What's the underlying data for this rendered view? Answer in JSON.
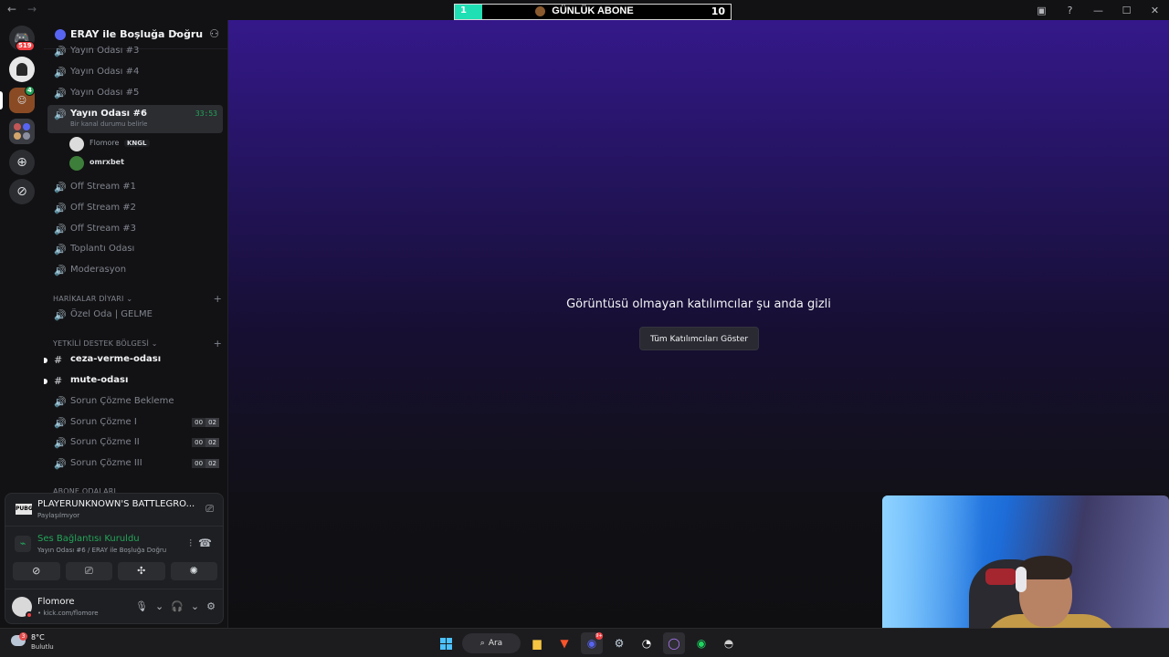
{
  "overlay": {
    "current": "1",
    "title": "GÜNLÜK ABONE",
    "goal": "10",
    "progress": 0.1
  },
  "rail": {
    "dm_badge": "519",
    "server_badge": "4",
    "add_icon": "plus-icon",
    "discover_icon": "compass-icon"
  },
  "guild": {
    "name": "ERAY ile Boşluğa Doğru"
  },
  "channels_top": [
    {
      "name": "Yayın Odası #3"
    },
    {
      "name": "Yayın Odası #4"
    },
    {
      "name": "Yayın Odası #5"
    }
  ],
  "active_channel": {
    "name": "Yayın Odası #6",
    "timer": "33:53",
    "status": "Bir kanal durumu belirle"
  },
  "voice_users": [
    {
      "name": "Flomore",
      "tag": "KNGL"
    },
    {
      "name": "omrxbet"
    }
  ],
  "channels_mid": [
    {
      "name": "Off Stream #1"
    },
    {
      "name": "Off Stream #2"
    },
    {
      "name": "Off Stream #3"
    },
    {
      "name": "Toplantı Odası"
    },
    {
      "name": "Moderasyon"
    }
  ],
  "categories": {
    "harikalar": "HARİKALAR DİYARI",
    "yetkili": "YETKİLİ DESTEK BÖLGESİ",
    "abone": "ABONE ODALARI"
  },
  "ozel_oda": {
    "name": "Özel Oda | GELME"
  },
  "text_channels": [
    {
      "name": "ceza-verme-odası"
    },
    {
      "name": "mute-odası"
    }
  ],
  "support_channels": [
    {
      "name": "Sorun Çözme Bekleme"
    },
    {
      "name": "Sorun Çözme I",
      "count_a": "00",
      "count_b": "02"
    },
    {
      "name": "Sorun Çözme II",
      "count_a": "00",
      "count_b": "02"
    },
    {
      "name": "Sorun Çözme III",
      "count_a": "00",
      "count_b": "02"
    }
  ],
  "activity": {
    "icon_text": "PUBG",
    "title": "PLAYERUNKNOWN'S BATTLEGRO...",
    "subtitle": "Paylaşılmıyor"
  },
  "voice": {
    "title": "Ses Bağlantısı Kuruldu",
    "subtitle": "Yayın Odası #6 / ERAY ile Boşluğa Doğru"
  },
  "me": {
    "name": "Flomore",
    "status": "• kick.com/flomore"
  },
  "stage": {
    "message": "Görüntüsü olmayan katılımcılar şu anda gizli",
    "button": "Tüm Katılımcıları Göster"
  },
  "taskbar": {
    "temperature": "8°C",
    "weather": "Bulutlu",
    "weather_badge": "3",
    "search": "Ara",
    "discord_badge": "9+"
  },
  "colors": {
    "accent_green": "#23a55a",
    "blurple": "#5865f2",
    "danger": "#f23f43",
    "overlay_fill": "#1ee0b4"
  }
}
